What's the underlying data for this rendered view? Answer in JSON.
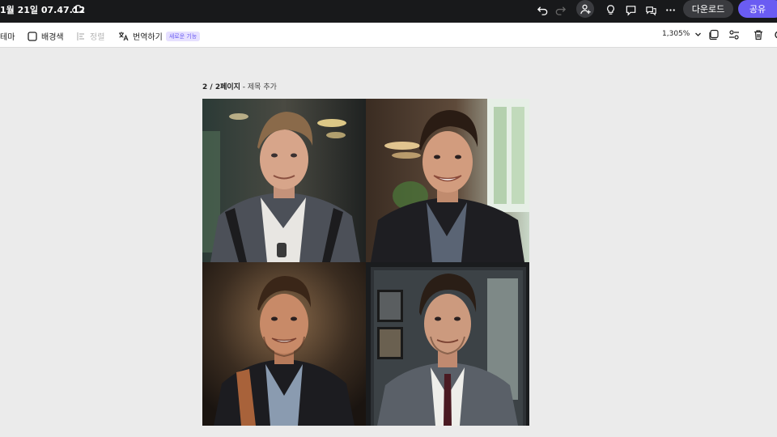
{
  "topbar": {
    "doc_title": "1월 21일 07.47.12",
    "icons": [
      "undo-icon",
      "redo-icon",
      "add-person-icon",
      "lightbulb-icon",
      "comment-icon",
      "chat-icon",
      "more-icon"
    ],
    "download_label": "다운로드",
    "share_label": "공유",
    "colors": {
      "bar": "#18191b",
      "share": "#6a5cf2",
      "download": "#3a3b3f"
    }
  },
  "toolbar": {
    "theme_label": "테마",
    "background_label": "배경색",
    "align_label": "정렬",
    "translate_label": "번역하기",
    "new_badge": "새로운 기능",
    "zoom_value": "1,305%"
  },
  "canvas": {
    "page_indicator": "2 / 2페이지",
    "page_sep": " - ",
    "title_placeholder": "제목 추가",
    "images": [
      "portrait-1",
      "portrait-2",
      "portrait-3",
      "portrait-4"
    ]
  }
}
